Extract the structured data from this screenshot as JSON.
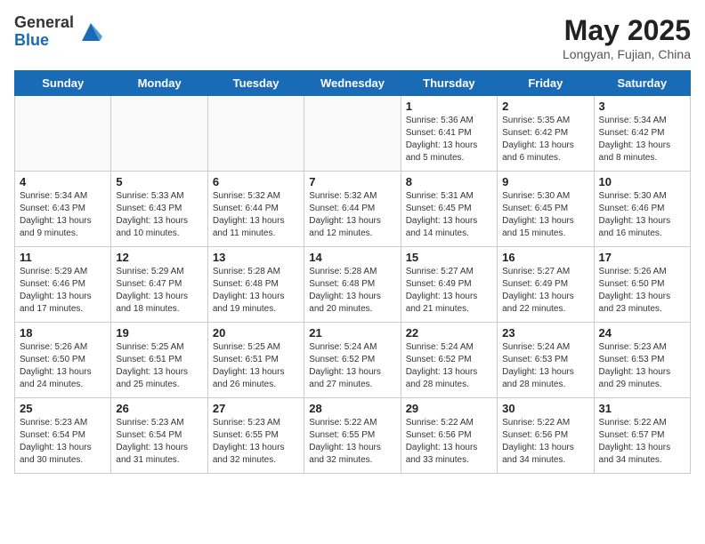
{
  "header": {
    "logo_general": "General",
    "logo_blue": "Blue",
    "month_year": "May 2025",
    "location": "Longyan, Fujian, China"
  },
  "days_of_week": [
    "Sunday",
    "Monday",
    "Tuesday",
    "Wednesday",
    "Thursday",
    "Friday",
    "Saturday"
  ],
  "weeks": [
    [
      {
        "day": "",
        "info": ""
      },
      {
        "day": "",
        "info": ""
      },
      {
        "day": "",
        "info": ""
      },
      {
        "day": "",
        "info": ""
      },
      {
        "day": "1",
        "info": "Sunrise: 5:36 AM\nSunset: 6:41 PM\nDaylight: 13 hours\nand 5 minutes."
      },
      {
        "day": "2",
        "info": "Sunrise: 5:35 AM\nSunset: 6:42 PM\nDaylight: 13 hours\nand 6 minutes."
      },
      {
        "day": "3",
        "info": "Sunrise: 5:34 AM\nSunset: 6:42 PM\nDaylight: 13 hours\nand 8 minutes."
      }
    ],
    [
      {
        "day": "4",
        "info": "Sunrise: 5:34 AM\nSunset: 6:43 PM\nDaylight: 13 hours\nand 9 minutes."
      },
      {
        "day": "5",
        "info": "Sunrise: 5:33 AM\nSunset: 6:43 PM\nDaylight: 13 hours\nand 10 minutes."
      },
      {
        "day": "6",
        "info": "Sunrise: 5:32 AM\nSunset: 6:44 PM\nDaylight: 13 hours\nand 11 minutes."
      },
      {
        "day": "7",
        "info": "Sunrise: 5:32 AM\nSunset: 6:44 PM\nDaylight: 13 hours\nand 12 minutes."
      },
      {
        "day": "8",
        "info": "Sunrise: 5:31 AM\nSunset: 6:45 PM\nDaylight: 13 hours\nand 14 minutes."
      },
      {
        "day": "9",
        "info": "Sunrise: 5:30 AM\nSunset: 6:45 PM\nDaylight: 13 hours\nand 15 minutes."
      },
      {
        "day": "10",
        "info": "Sunrise: 5:30 AM\nSunset: 6:46 PM\nDaylight: 13 hours\nand 16 minutes."
      }
    ],
    [
      {
        "day": "11",
        "info": "Sunrise: 5:29 AM\nSunset: 6:46 PM\nDaylight: 13 hours\nand 17 minutes."
      },
      {
        "day": "12",
        "info": "Sunrise: 5:29 AM\nSunset: 6:47 PM\nDaylight: 13 hours\nand 18 minutes."
      },
      {
        "day": "13",
        "info": "Sunrise: 5:28 AM\nSunset: 6:48 PM\nDaylight: 13 hours\nand 19 minutes."
      },
      {
        "day": "14",
        "info": "Sunrise: 5:28 AM\nSunset: 6:48 PM\nDaylight: 13 hours\nand 20 minutes."
      },
      {
        "day": "15",
        "info": "Sunrise: 5:27 AM\nSunset: 6:49 PM\nDaylight: 13 hours\nand 21 minutes."
      },
      {
        "day": "16",
        "info": "Sunrise: 5:27 AM\nSunset: 6:49 PM\nDaylight: 13 hours\nand 22 minutes."
      },
      {
        "day": "17",
        "info": "Sunrise: 5:26 AM\nSunset: 6:50 PM\nDaylight: 13 hours\nand 23 minutes."
      }
    ],
    [
      {
        "day": "18",
        "info": "Sunrise: 5:26 AM\nSunset: 6:50 PM\nDaylight: 13 hours\nand 24 minutes."
      },
      {
        "day": "19",
        "info": "Sunrise: 5:25 AM\nSunset: 6:51 PM\nDaylight: 13 hours\nand 25 minutes."
      },
      {
        "day": "20",
        "info": "Sunrise: 5:25 AM\nSunset: 6:51 PM\nDaylight: 13 hours\nand 26 minutes."
      },
      {
        "day": "21",
        "info": "Sunrise: 5:24 AM\nSunset: 6:52 PM\nDaylight: 13 hours\nand 27 minutes."
      },
      {
        "day": "22",
        "info": "Sunrise: 5:24 AM\nSunset: 6:52 PM\nDaylight: 13 hours\nand 28 minutes."
      },
      {
        "day": "23",
        "info": "Sunrise: 5:24 AM\nSunset: 6:53 PM\nDaylight: 13 hours\nand 28 minutes."
      },
      {
        "day": "24",
        "info": "Sunrise: 5:23 AM\nSunset: 6:53 PM\nDaylight: 13 hours\nand 29 minutes."
      }
    ],
    [
      {
        "day": "25",
        "info": "Sunrise: 5:23 AM\nSunset: 6:54 PM\nDaylight: 13 hours\nand 30 minutes."
      },
      {
        "day": "26",
        "info": "Sunrise: 5:23 AM\nSunset: 6:54 PM\nDaylight: 13 hours\nand 31 minutes."
      },
      {
        "day": "27",
        "info": "Sunrise: 5:23 AM\nSunset: 6:55 PM\nDaylight: 13 hours\nand 32 minutes."
      },
      {
        "day": "28",
        "info": "Sunrise: 5:22 AM\nSunset: 6:55 PM\nDaylight: 13 hours\nand 32 minutes."
      },
      {
        "day": "29",
        "info": "Sunrise: 5:22 AM\nSunset: 6:56 PM\nDaylight: 13 hours\nand 33 minutes."
      },
      {
        "day": "30",
        "info": "Sunrise: 5:22 AM\nSunset: 6:56 PM\nDaylight: 13 hours\nand 34 minutes."
      },
      {
        "day": "31",
        "info": "Sunrise: 5:22 AM\nSunset: 6:57 PM\nDaylight: 13 hours\nand 34 minutes."
      }
    ]
  ]
}
